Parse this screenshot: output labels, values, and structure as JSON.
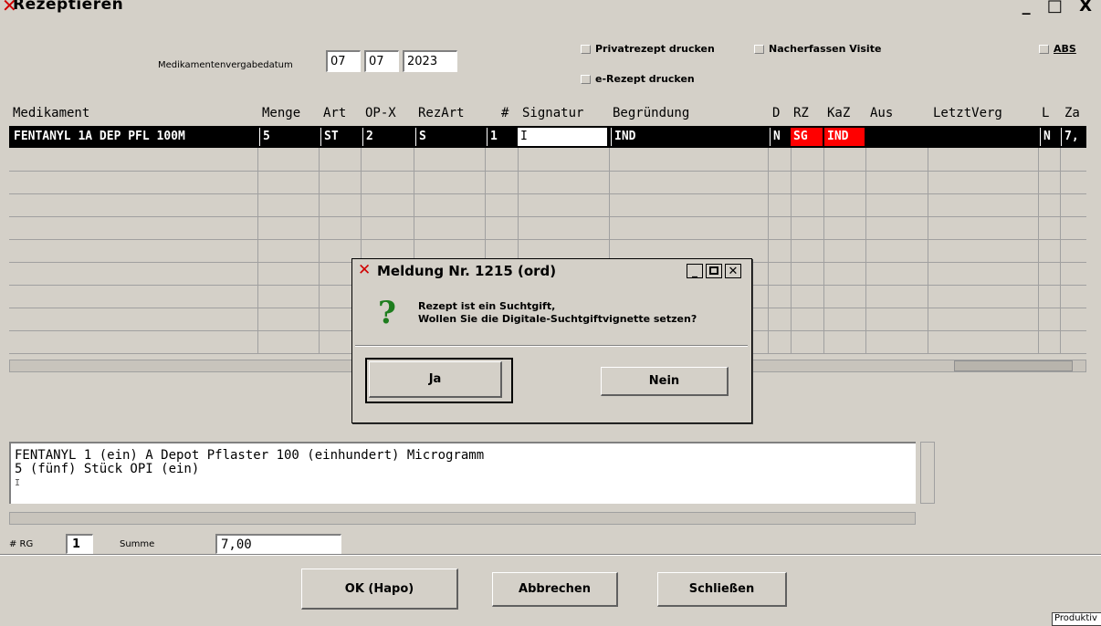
{
  "window": {
    "title": "Rezeptieren",
    "controls": "_ □ X"
  },
  "date": {
    "label": "Medikamentenvergabedatum",
    "day": "07",
    "month": "07",
    "year": "2023"
  },
  "options": {
    "privat": "Privatrezept drucken",
    "nacherfassen": "Nacherfassen Visite",
    "abs": "ABS",
    "erezept": "e-Rezept drucken"
  },
  "table": {
    "headers": [
      "Medikament",
      "Menge",
      "Art",
      "OP-X",
      "RezArt",
      "#",
      "Signatur",
      "Begründung",
      "D",
      "RZ",
      "KaZ",
      "Aus",
      "LetztVerg",
      "L",
      "Za"
    ],
    "row": {
      "medikament": "FENTANYL 1A DEP PFL 100M",
      "menge": "5",
      "art": "ST",
      "opx": "2",
      "rezart": "S",
      "nr": "1",
      "signatur": "I",
      "begruendung": "IND",
      "d": "N",
      "rz": "SG",
      "kaz": "IND",
      "l": "N",
      "za": "7,"
    }
  },
  "description": {
    "line1": "FENTANYL 1 (ein) A Depot Pflaster 100 (einhundert) Microgramm",
    "line2": "5 (fünf) Stück OPI (ein)"
  },
  "footer": {
    "rg_label": "# RG",
    "rg_value": "1",
    "summe_label": "Summe",
    "summe_value": "7,00"
  },
  "buttons": {
    "ok": "OK (Hapo)",
    "abbrechen": "Abbrechen",
    "schliessen": "Schließen"
  },
  "status": "Produktiv",
  "dialog": {
    "title": "Meldung Nr. 1215 (ord)",
    "line1": "Rezept ist ein Suchtgift,",
    "line2": "Wollen Sie die Digitale-Suchtgiftvignette setzen?",
    "yes": "Ja",
    "no": "Nein",
    "icon": "question-icon",
    "icon_color": "#1e7d1e"
  },
  "colors": {
    "selected_row": "#000000",
    "alert_cell": "#ff0000"
  }
}
